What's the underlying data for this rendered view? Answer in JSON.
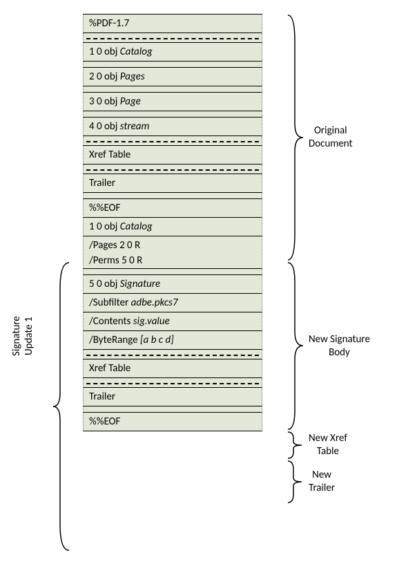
{
  "vertical_label_line1": "Signature",
  "vertical_label_line2": "Update 1",
  "original": {
    "header": "%PDF-1.7",
    "obj1": "1 0 obj ",
    "obj1_type": "Catalog",
    "obj2": "2 0 obj ",
    "obj2_type": "Pages",
    "obj3": "3 0 obj ",
    "obj3_type": "Page",
    "obj4": "4 0 obj ",
    "obj4_type": "stream",
    "xref": "Xref Table",
    "trailer": "Trailer",
    "eof": "%%EOF"
  },
  "sig_body": {
    "obj1": "1 0 obj ",
    "obj1_type": "Catalog",
    "pages_ref": "/Pages 2 0 R",
    "perms_ref": "/Perms 5 0 R",
    "obj5": "5 0 obj ",
    "obj5_type": "Signature",
    "subfilter_key": "/Subfilter ",
    "subfilter_val": "adbe.pkcs7",
    "contents_key": "/Contents ",
    "contents_val": "sig.value",
    "byterange_key": "/ByteRange ",
    "byterange_val": "[a b c d]"
  },
  "new_xref": {
    "xref": "Xref Table"
  },
  "new_trailer": {
    "trailer": "Trailer",
    "eof": "%%EOF"
  },
  "labels": {
    "original": "Original Document",
    "sig_body": "New Signature Body",
    "new_xref": "New Xref Table",
    "new_trailer": "New Trailer"
  }
}
